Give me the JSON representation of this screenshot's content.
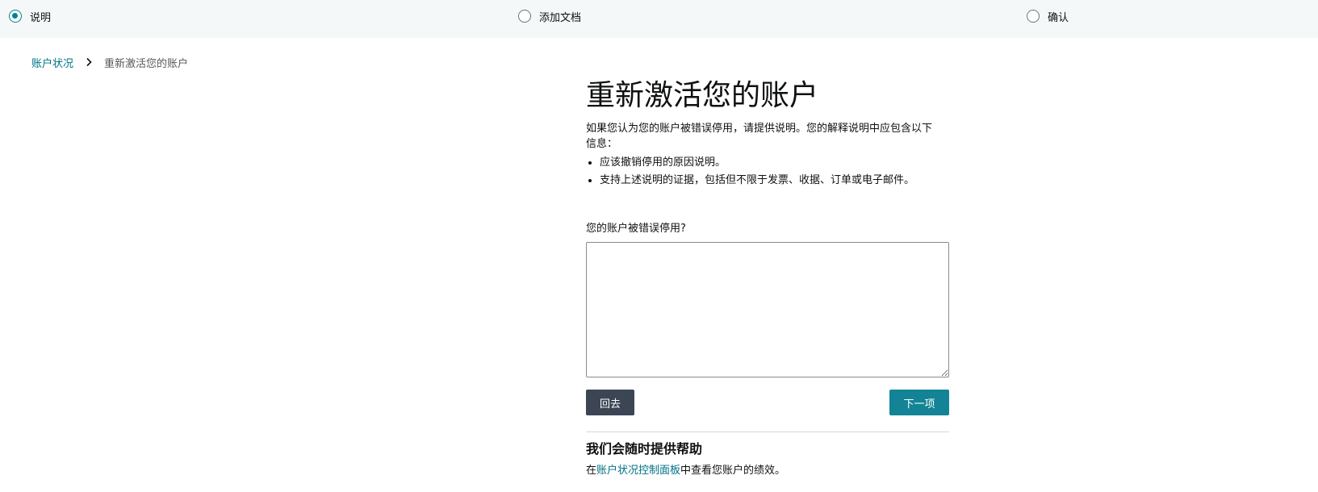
{
  "stepper": {
    "steps": [
      {
        "label": "说明",
        "state": "active"
      },
      {
        "label": "添加文档",
        "state": "inactive"
      },
      {
        "label": "确认",
        "state": "inactive"
      }
    ],
    "accent_color": "#008296"
  },
  "breadcrumb": {
    "parent": "账户状况",
    "separator_icon": "chevron-right-icon",
    "current": "重新激活您的账户"
  },
  "main": {
    "title": "重新激活您的账户",
    "intro": "如果您认为您的账户被错误停用，请提供说明。您的解释说明中应包含以下信息：",
    "bullets": [
      "应该撤销停用的原因说明。",
      "支持上述说明的证据，包括但不限于发票、收据、订单或电子邮件。"
    ],
    "field_label": "您的账户被错误停用?",
    "textarea_value": "",
    "back_button": "回去",
    "next_button": "下一项"
  },
  "help": {
    "title": "我们会随时提供帮助",
    "text_before": "在",
    "link": "账户状况控制面板",
    "text_after": "中查看您账户的绩效。"
  }
}
